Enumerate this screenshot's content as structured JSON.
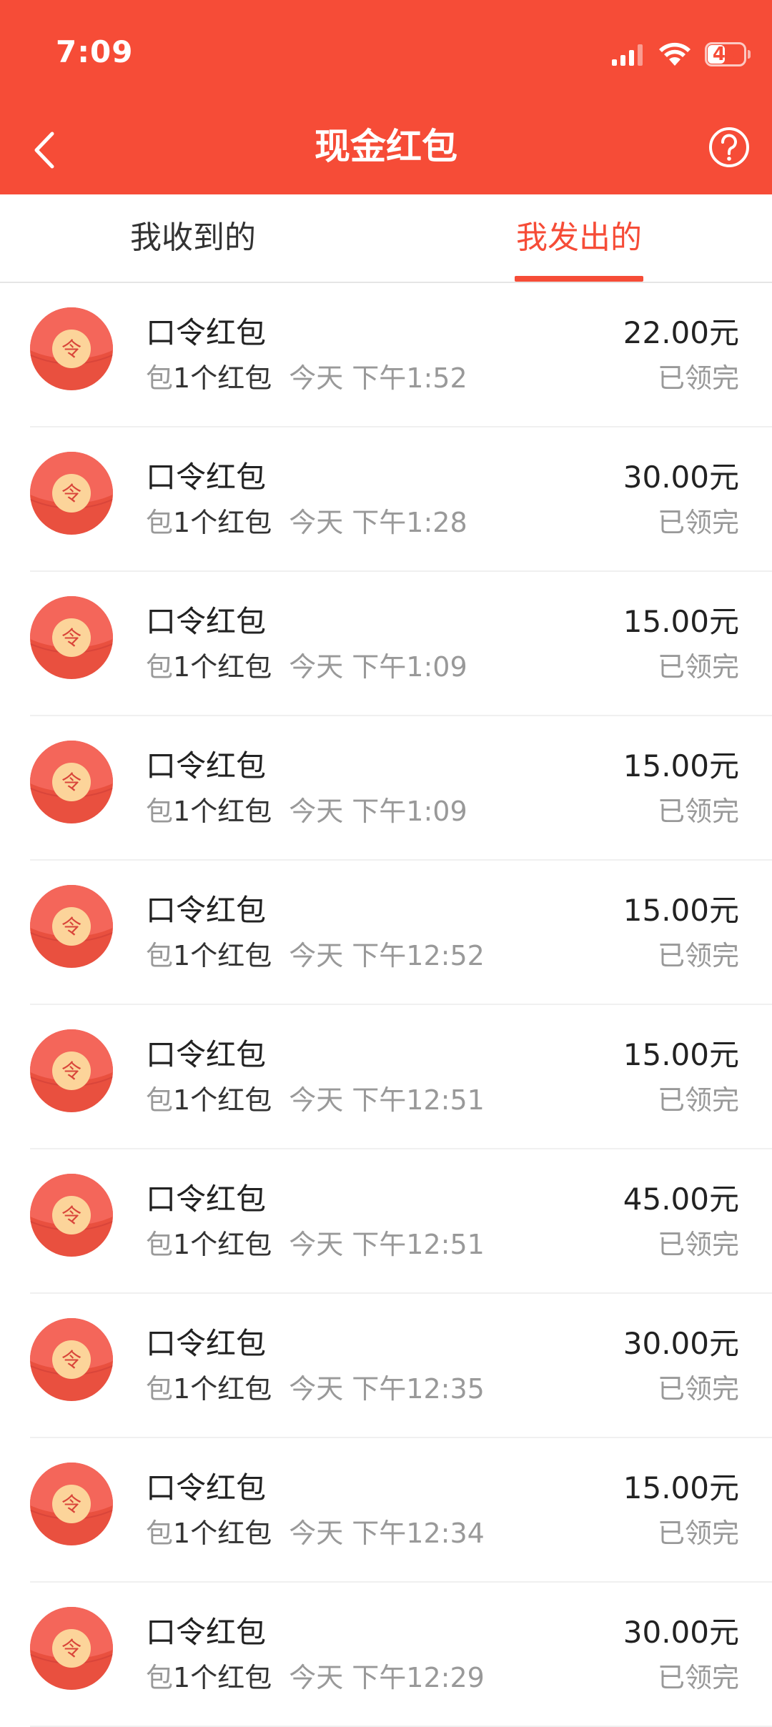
{
  "status_bar": {
    "time": "7:09",
    "battery_level": "48",
    "icons": [
      "signal-icon",
      "wifi-icon",
      "battery-icon"
    ]
  },
  "nav": {
    "title": "现金红包",
    "back_icon": "chevron-left-icon",
    "help_icon": "question-circle-icon"
  },
  "tabs": [
    {
      "label": "我收到的",
      "active": false
    },
    {
      "label": "我发出的",
      "active": true
    }
  ],
  "colors": {
    "brand": "#F64C37",
    "text_primary": "#222222",
    "text_secondary": "#999999",
    "envelope_red": "#E9503F",
    "envelope_seal": "#FCD49A"
  },
  "items": [
    {
      "title": "口令红包",
      "prefix": "包",
      "count": "1个红包",
      "time": "今天 下午1:52",
      "amount": "22.00元",
      "status": "已领完",
      "seal": "令"
    },
    {
      "title": "口令红包",
      "prefix": "包",
      "count": "1个红包",
      "time": "今天 下午1:28",
      "amount": "30.00元",
      "status": "已领完",
      "seal": "令"
    },
    {
      "title": "口令红包",
      "prefix": "包",
      "count": "1个红包",
      "time": "今天 下午1:09",
      "amount": "15.00元",
      "status": "已领完",
      "seal": "令"
    },
    {
      "title": "口令红包",
      "prefix": "包",
      "count": "1个红包",
      "time": "今天 下午1:09",
      "amount": "15.00元",
      "status": "已领完",
      "seal": "令"
    },
    {
      "title": "口令红包",
      "prefix": "包",
      "count": "1个红包",
      "time": "今天 下午12:52",
      "amount": "15.00元",
      "status": "已领完",
      "seal": "令"
    },
    {
      "title": "口令红包",
      "prefix": "包",
      "count": "1个红包",
      "time": "今天 下午12:51",
      "amount": "15.00元",
      "status": "已领完",
      "seal": "令"
    },
    {
      "title": "口令红包",
      "prefix": "包",
      "count": "1个红包",
      "time": "今天 下午12:51",
      "amount": "45.00元",
      "status": "已领完",
      "seal": "令"
    },
    {
      "title": "口令红包",
      "prefix": "包",
      "count": "1个红包",
      "time": "今天 下午12:35",
      "amount": "30.00元",
      "status": "已领完",
      "seal": "令"
    },
    {
      "title": "口令红包",
      "prefix": "包",
      "count": "1个红包",
      "time": "今天 下午12:34",
      "amount": "15.00元",
      "status": "已领完",
      "seal": "令"
    },
    {
      "title": "口令红包",
      "prefix": "包",
      "count": "1个红包",
      "time": "今天 下午12:29",
      "amount": "30.00元",
      "status": "已领完",
      "seal": "令"
    }
  ]
}
